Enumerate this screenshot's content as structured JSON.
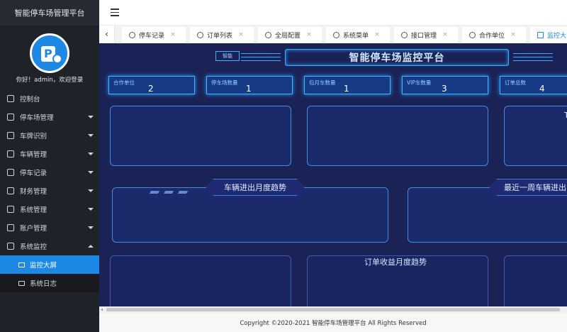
{
  "app": {
    "title": "智能停车场管理平台"
  },
  "user": {
    "welcome": "你好！admin，欢迎登录"
  },
  "sidebar": {
    "items": [
      {
        "label": "控制台"
      },
      {
        "label": "停车场管理"
      },
      {
        "label": "车牌识别"
      },
      {
        "label": "车辆管理"
      },
      {
        "label": "停车记录"
      },
      {
        "label": "财务管理"
      },
      {
        "label": "系统管理"
      },
      {
        "label": "账户管理"
      },
      {
        "label": "系统监控"
      }
    ],
    "subitems": [
      {
        "label": "监控大屏"
      },
      {
        "label": "系统日志"
      }
    ]
  },
  "tabs": {
    "items": [
      {
        "label": "停车记录"
      },
      {
        "label": "订单列表"
      },
      {
        "label": "全局配置"
      },
      {
        "label": "系统菜单"
      },
      {
        "label": "接口管理"
      },
      {
        "label": "合作单位"
      },
      {
        "label": "监控大"
      }
    ],
    "close": "×",
    "back": "‹"
  },
  "dashboard": {
    "title": "智能停车场监控平台",
    "tag": "智能",
    "stats": [
      {
        "label": "合作单位",
        "value": "2"
      },
      {
        "label": "停车场数量",
        "value": "1"
      },
      {
        "label": "包月车数量",
        "value": "1"
      },
      {
        "label": "VIP车数量",
        "value": "3"
      },
      {
        "label": "订单总数",
        "value": "4"
      }
    ],
    "panel_titles": {
      "vehicle_monthly": "车辆进出月度趋势",
      "weekly_vehicle": "最近一周车辆进出",
      "order_revenue": "订单收益月度趋势",
      "partial_t": "T"
    }
  },
  "footer": {
    "copyright": "Copyright ©2020-2021 智能停车场管理平台 All Rights Reserved"
  },
  "colors": {
    "accent": "#1e88e5",
    "sidebar_bg": "#20222a",
    "dashboard_bg": "#1b2256",
    "glow": "#3db9ff"
  }
}
